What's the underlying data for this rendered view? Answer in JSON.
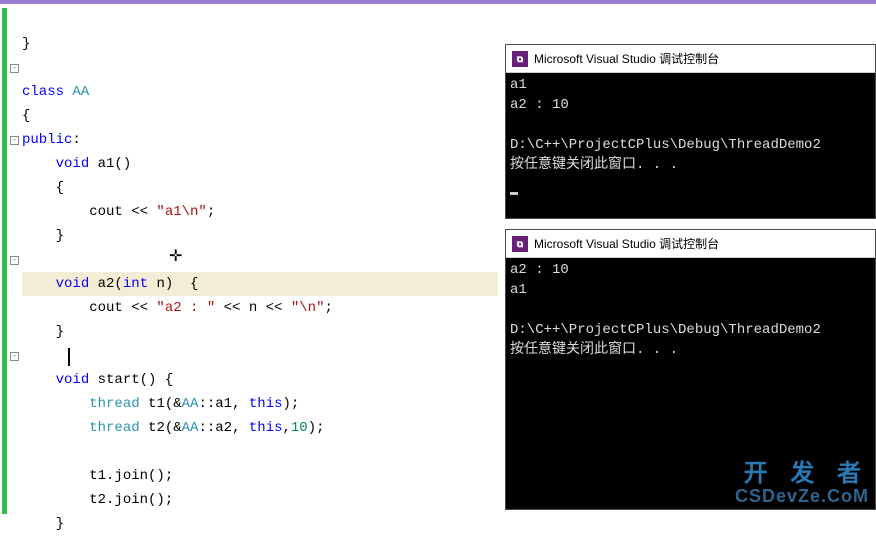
{
  "code": {
    "lines": [
      "}",
      "",
      "class AA",
      "{",
      "public:",
      "    void a1()",
      "    {",
      "        cout << \"a1\\n\";",
      "    }",
      "",
      "    void a2(int n)  {",
      "        cout << \"a2 : \" << n << \"\\n\";",
      "    }",
      "",
      "    void start() {",
      "        thread t1(&AA::a1, this);",
      "        thread t2(&AA::a2, this,10);",
      "",
      "        t1.join();",
      "        t2.join();",
      "    }"
    ],
    "keywords": {
      "class": "class",
      "public": "public",
      "void": "void",
      "int": "int",
      "this": "this"
    },
    "types": {
      "AA": "AA",
      "thread": "thread"
    },
    "strings": {
      "s1": "\"a1\\n\"",
      "s2": "\"a2 : \"",
      "s3": "\"\\n\""
    },
    "numbers": {
      "n10": "10"
    }
  },
  "console1": {
    "title": "Microsoft Visual Studio 调试控制台",
    "lines": {
      "l1": "a1",
      "l2": "a2 : 10",
      "l3": "",
      "l4": "D:\\C++\\ProjectCPlus\\Debug\\ThreadDemo2",
      "l5": "按任意键关闭此窗口. . ."
    }
  },
  "console2": {
    "title": "Microsoft Visual Studio 调试控制台",
    "lines": {
      "l1": "a2 : 10",
      "l2": "a1",
      "l3": "",
      "l4": "D:\\C++\\ProjectCPlus\\Debug\\ThreadDemo2",
      "l5": "按任意键关闭此窗口. . ."
    }
  },
  "watermark": {
    "top": "开 发 者",
    "bottom": "CSDevZe.CoM"
  },
  "icon": {
    "vs": "⧉"
  }
}
